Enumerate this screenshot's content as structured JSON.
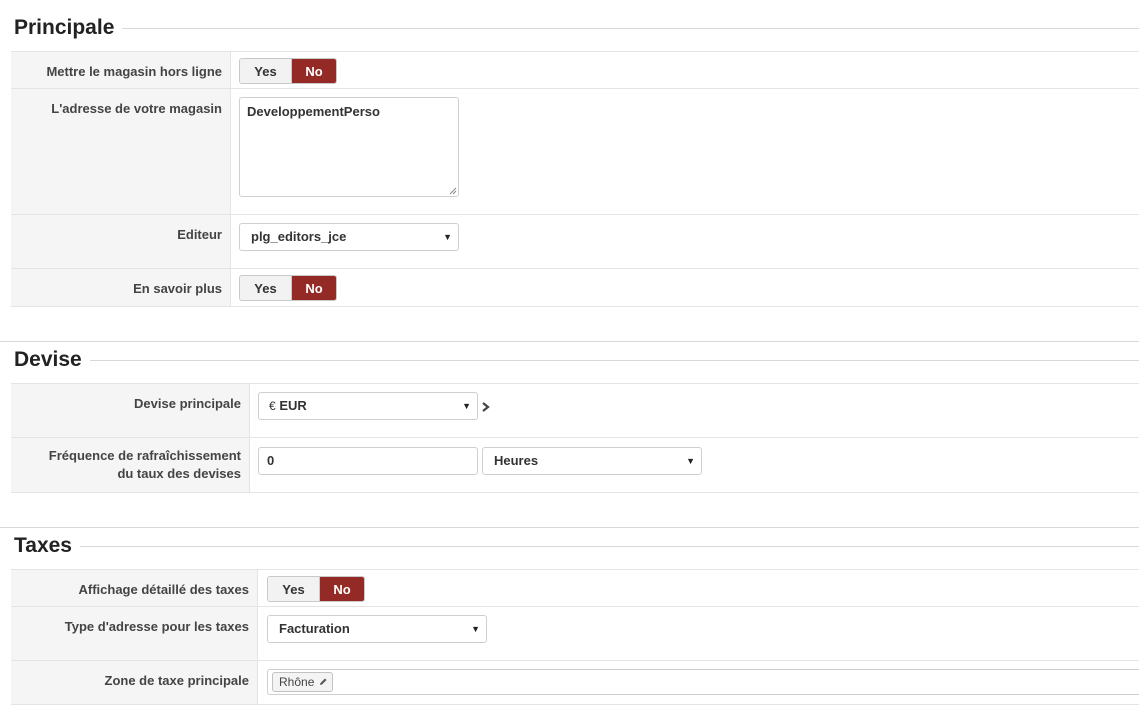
{
  "sections": {
    "principale": {
      "title": "Principale",
      "offline_label": "Mettre le magasin hors ligne",
      "address_label": "L'adresse de votre magasin",
      "address_value": "DeveloppementPerso",
      "editor_label": "Editeur",
      "editor_value": "plg_editors_jce",
      "learn_more_label": "En savoir plus"
    },
    "devise": {
      "title": "Devise",
      "main_currency_label": "Devise principale",
      "currency_symbol": "€",
      "currency_value": "EUR",
      "refresh_label_1": "Fréquence de rafraîchissement",
      "refresh_label_2": "du taux des devises",
      "refresh_value": "0",
      "refresh_unit": "Heures"
    },
    "taxes": {
      "title": "Taxes",
      "detailed_label": "Affichage détaillé des taxes",
      "address_type_label": "Type d'adresse pour les taxes",
      "address_type_value": "Facturation",
      "zone_label": "Zone de taxe principale",
      "zone_chip": "Rhône"
    }
  },
  "toggle": {
    "yes": "Yes",
    "no": "No",
    "selected": "No"
  },
  "colors": {
    "toggle_active": "#942a25",
    "label_bg": "#f5f5f5"
  },
  "icons": {
    "dropdown": "caret-down-icon",
    "arrow": "chevron-right-icon",
    "edit": "pencil-icon"
  }
}
